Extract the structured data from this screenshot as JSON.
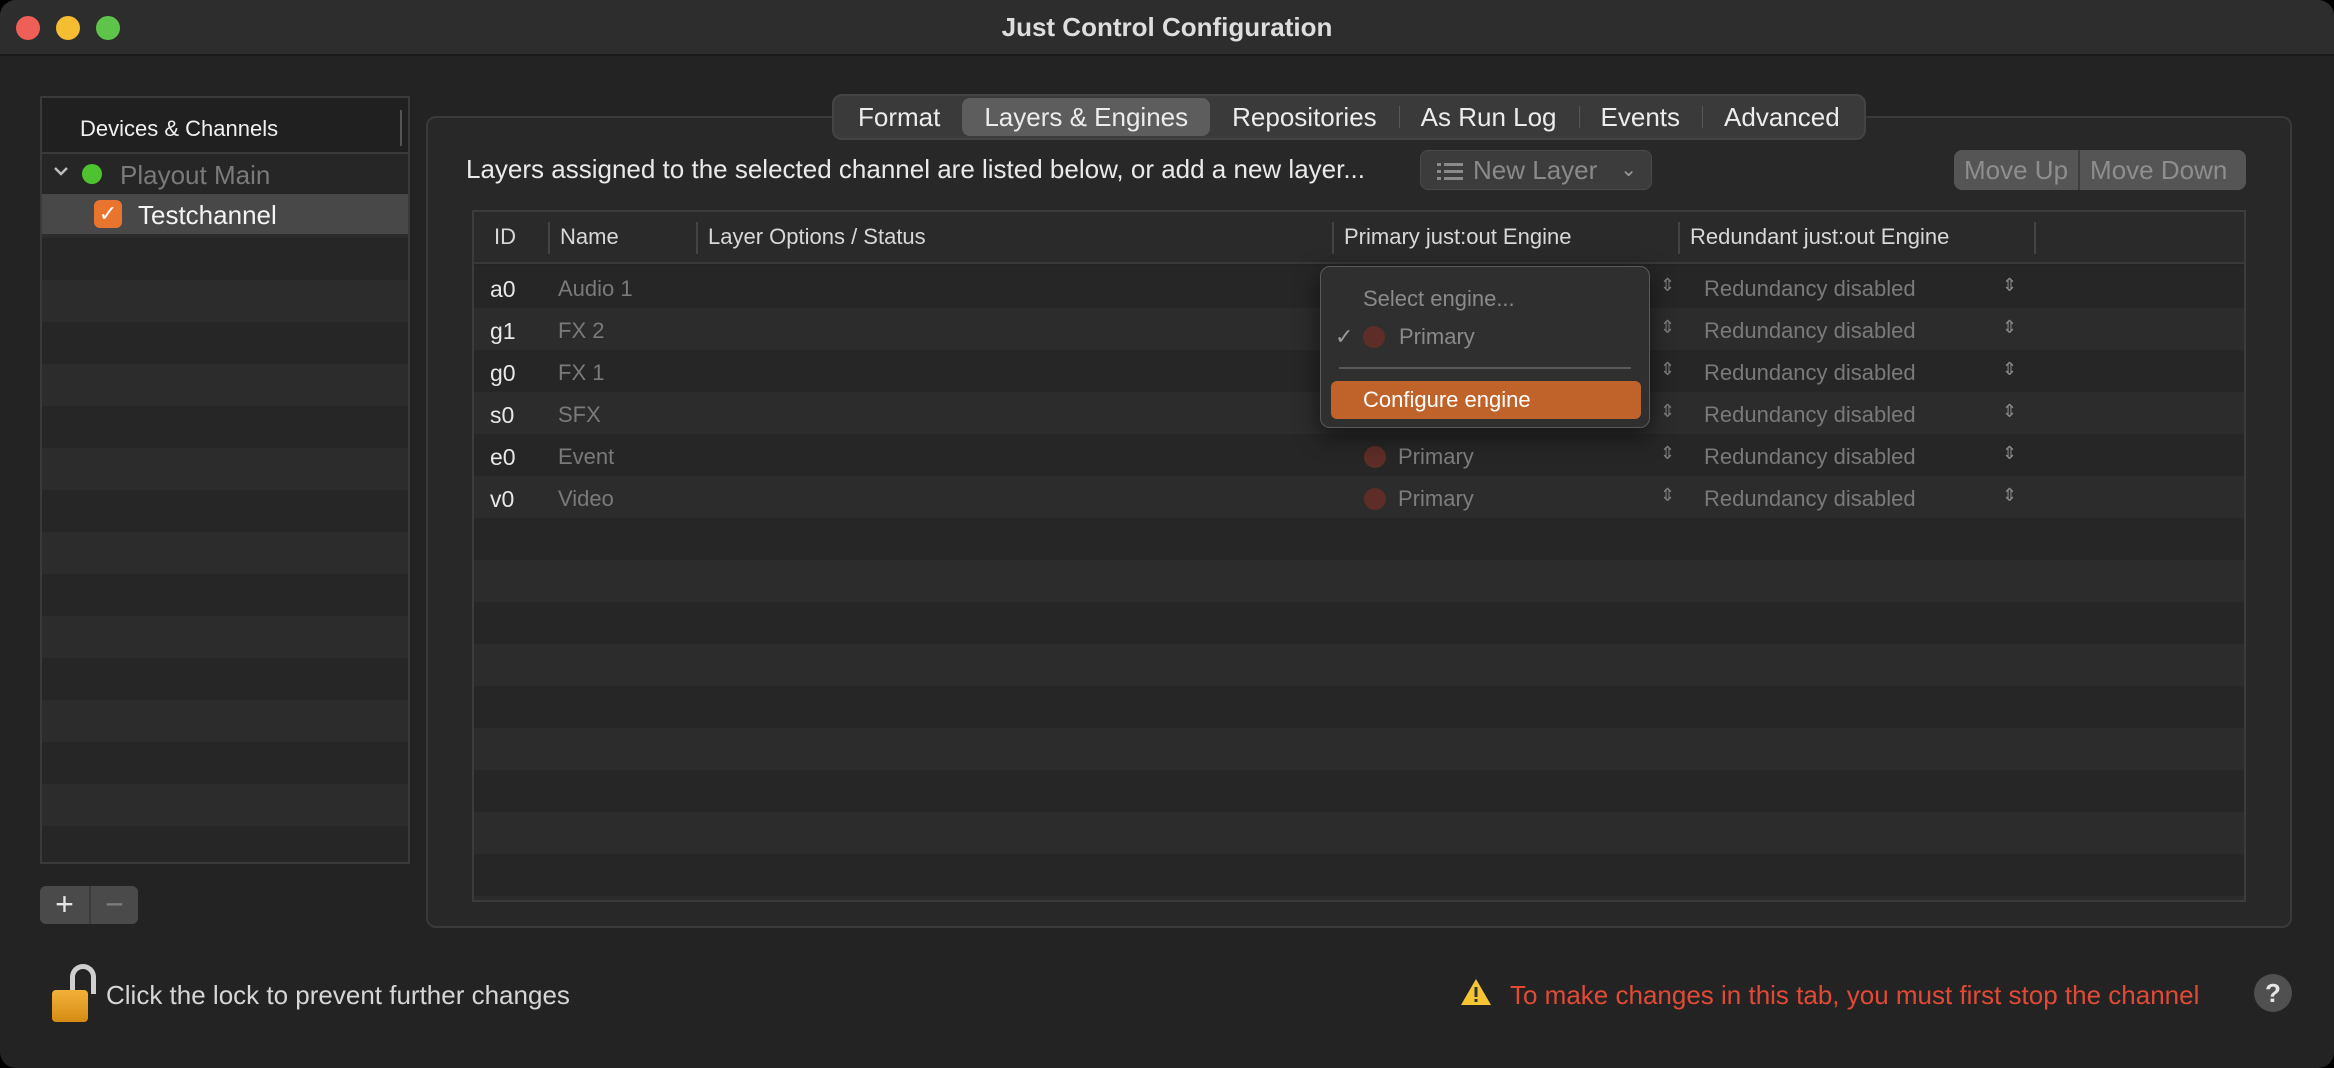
{
  "window": {
    "title": "Just Control Configuration"
  },
  "sidebar": {
    "header": "Devices & Channels",
    "device": {
      "label": "Playout Main",
      "status_color": "#4fc32f"
    },
    "channel": {
      "label": "Testchannel",
      "checked": true
    },
    "add_label": "+",
    "remove_label": "−"
  },
  "tabs": [
    {
      "label": "Format"
    },
    {
      "label": "Layers & Engines",
      "active": true
    },
    {
      "label": "Repositories"
    },
    {
      "label": "As Run Log"
    },
    {
      "label": "Events"
    },
    {
      "label": "Advanced"
    }
  ],
  "layers": {
    "info_text": "Layers assigned to the selected channel are listed below, or add a new layer...",
    "new_layer_label": "New Layer",
    "move_up_label": "Move Up",
    "move_down_label": "Move Down",
    "columns": {
      "id": "ID",
      "name": "Name",
      "options": "Layer Options / Status",
      "primary": "Primary just:out Engine",
      "redundant": "Redundant just:out Engine"
    },
    "rows": [
      {
        "id": "a0",
        "name": "Audio 1",
        "primary": "Primary",
        "redundant": "Redundancy disabled"
      },
      {
        "id": "g1",
        "name": "FX 2",
        "primary": "Primary",
        "redundant": "Redundancy disabled"
      },
      {
        "id": "g0",
        "name": "FX 1",
        "primary": "Primary",
        "redundant": "Redundancy disabled"
      },
      {
        "id": "s0",
        "name": "SFX",
        "primary": "Primary",
        "redundant": "Redundancy disabled"
      },
      {
        "id": "e0",
        "name": "Event",
        "primary": "Primary",
        "redundant": "Redundancy disabled"
      },
      {
        "id": "v0",
        "name": "Video",
        "primary": "Primary",
        "redundant": "Redundancy disabled"
      }
    ]
  },
  "engine_menu": {
    "select_label": "Select engine...",
    "primary_label": "Primary",
    "configure_label": "Configure engine"
  },
  "footer": {
    "lock_text": "Click the lock to prevent further changes",
    "warning_text": "To make changes in this tab, you must first stop the channel",
    "help_label": "?"
  },
  "colors": {
    "accent": "#e8742e",
    "warning": "#e24a36",
    "engine_status": "#5e2d27"
  }
}
